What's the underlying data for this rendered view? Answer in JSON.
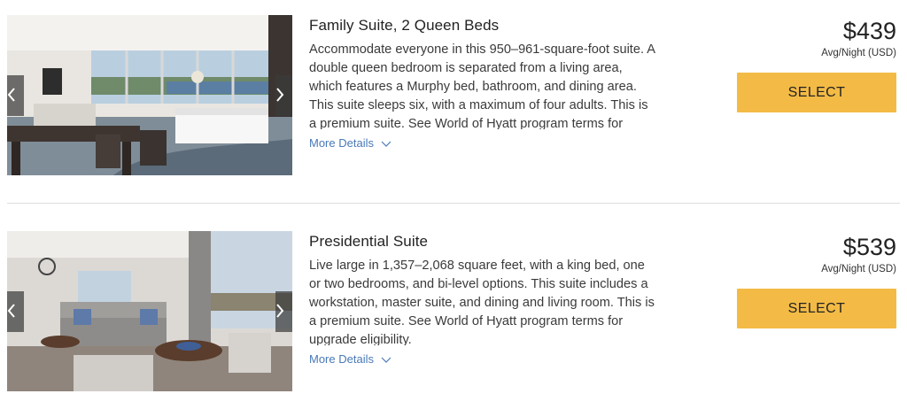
{
  "rooms": [
    {
      "title": "Family Suite, 2 Queen Beds",
      "description": "Accommodate everyone in this 950–961-square-foot suite. A double queen bedroom is separated from a living area, which features a Murphy bed, bathroom, and dining area. This suite sleeps six, with a maximum of four adults. This is a premium suite. See World of Hyatt program terms for upgrade eligibility.",
      "more_details": "More Details",
      "price": "$439",
      "price_note": "Avg/Night (USD)",
      "select_label": "SELECT",
      "image_alt": "family-suite-photo"
    },
    {
      "title": "Presidential Suite",
      "description": "Live large in 1,357–2,068 square feet, with a king bed, one or two bedrooms, and bi-level options. This suite includes a workstation, master suite, and dining and living room. This is a premium suite. See World of Hyatt program terms for upgrade eligibility.",
      "more_details": "More Details",
      "price": "$539",
      "price_note": "Avg/Night (USD)",
      "select_label": "SELECT",
      "image_alt": "presidential-suite-photo"
    }
  ],
  "icons": {
    "prev": "chevron-left-icon",
    "next": "chevron-right-icon",
    "expand": "chevron-down-icon"
  },
  "colors": {
    "select_button": "#f3bb45",
    "link": "#4a79b8",
    "divider": "#dddddd"
  }
}
